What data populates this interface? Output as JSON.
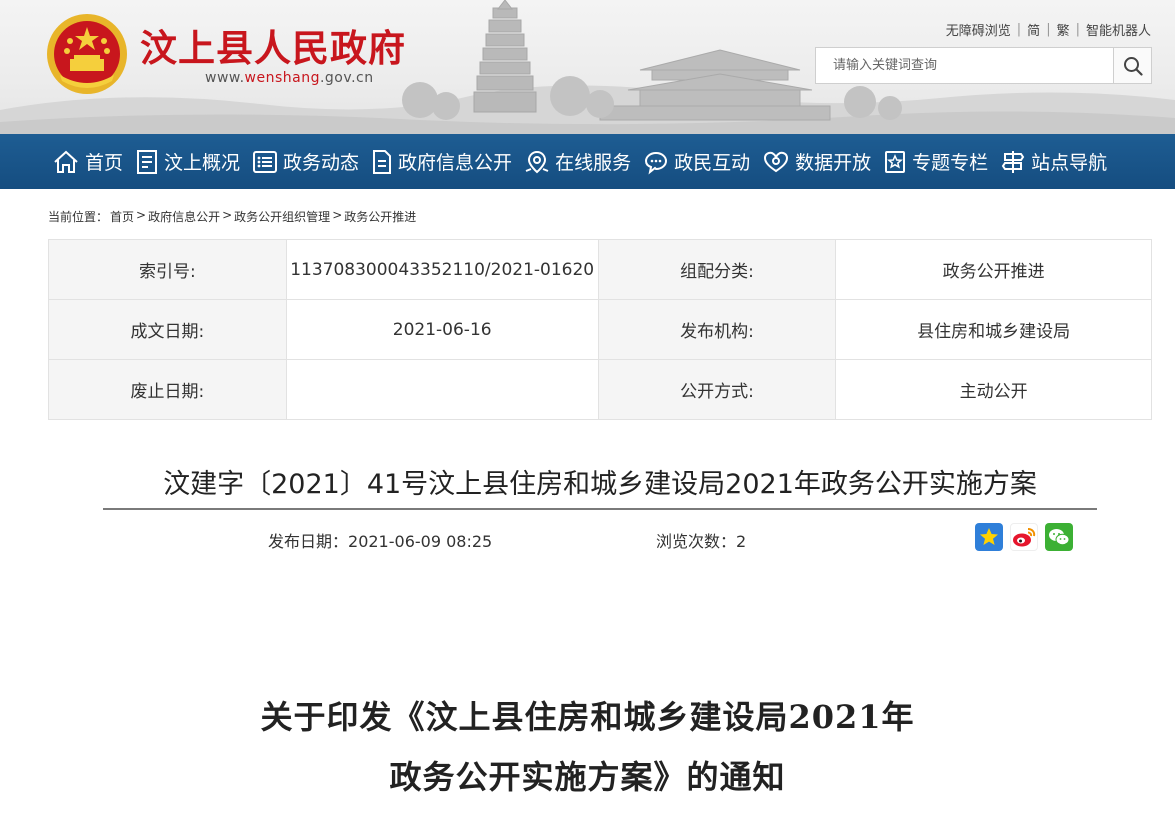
{
  "header": {
    "site_name": "汶上县人民政府",
    "site_url_prefix": "www.",
    "site_url_domain": "wenshang",
    "site_url_suffix": ".gov.cn",
    "top_links": [
      "无障碍浏览",
      "简",
      "繁",
      "智能机器人"
    ],
    "search_placeholder": "请输入关键词查询",
    "brand_color": "#c8161d"
  },
  "nav": {
    "color": "#1a5890",
    "items": [
      {
        "label": "首页",
        "icon": "home-icon"
      },
      {
        "label": "汶上概况",
        "icon": "document-list-icon"
      },
      {
        "label": "政务动态",
        "icon": "list-icon"
      },
      {
        "label": "政府信息公开",
        "icon": "file-icon"
      },
      {
        "label": "在线服务",
        "icon": "location-pin-icon"
      },
      {
        "label": "政民互动",
        "icon": "chat-bubble-icon"
      },
      {
        "label": "数据开放",
        "icon": "data-icon"
      },
      {
        "label": "专题专栏",
        "icon": "star-badge-icon"
      },
      {
        "label": "站点导航",
        "icon": "signpost-icon"
      }
    ]
  },
  "breadcrumb": {
    "prefix": "当前位置：",
    "items": [
      "首页",
      "政府信息公开",
      "政务公开组织管理",
      "政务公开推进"
    ]
  },
  "info_table": {
    "rows": [
      {
        "k1": "索引号:",
        "v1": "113708300043352110/2021-01620",
        "k2": "组配分类:",
        "v2": "政务公开推进"
      },
      {
        "k1": "成文日期:",
        "v1": "2021-06-16",
        "k2": "发布机构:",
        "v2": "县住房和城乡建设局"
      },
      {
        "k1": "废止日期:",
        "v1": "",
        "k2": "公开方式:",
        "v2": "主动公开"
      }
    ]
  },
  "article": {
    "title": "汶建字〔2021〕41号汶上县住房和城乡建设局2021年政务公开实施方案",
    "publish_date_label": "发布日期：",
    "publish_date": "2021-06-09 08:25",
    "views_label": "浏览次数：",
    "views": "2",
    "share_icons": [
      "qzone-star-icon",
      "weibo-icon",
      "wechat-icon"
    ]
  },
  "document": {
    "heading_line1": "关于印发《汶上县住房和城乡建设局2021年",
    "heading_line2": "政务公开实施方案》的通知"
  }
}
